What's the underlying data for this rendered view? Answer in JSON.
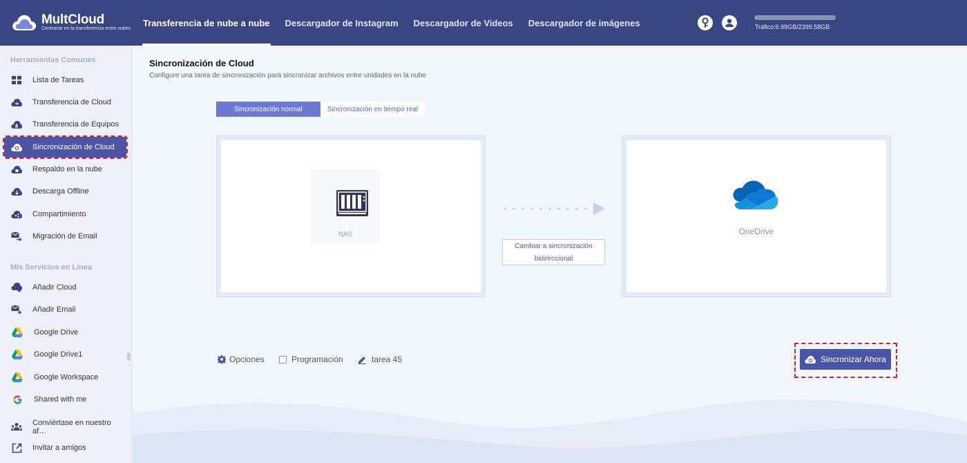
{
  "brand": {
    "name": "MultCloud",
    "tagline": "Centrarse en la transferencia entre nubes",
    "logo_icon": "cloud-logo-icon",
    "accent_color": "#3a4583"
  },
  "nav": {
    "items": [
      {
        "label": "Transferencia de nube a nube",
        "active": true
      },
      {
        "label": "Descargador de Instagram",
        "active": false
      },
      {
        "label": "Descargador de Videos",
        "active": false
      },
      {
        "label": "Descargador de imágenes",
        "active": false
      }
    ]
  },
  "header": {
    "help_icon": "key-icon",
    "user_icon": "user-icon",
    "traffic_text": "Tráfico:6.99GB/2399.58GB",
    "traffic_used_fraction": 0.003
  },
  "sidebar": {
    "common_heading": "Herramientas Comunes",
    "common_items": [
      {
        "label": "Lista de Tareas",
        "icon": "grid-icon"
      },
      {
        "label": "Transferencia de Cloud",
        "icon": "cloud-transfer-icon"
      },
      {
        "label": "Transferencia de Equipos",
        "icon": "team-cloud-icon"
      },
      {
        "label": "Sincronización de Cloud",
        "icon": "cloud-sync-icon",
        "active": true
      },
      {
        "label": "Respaldo en la nube",
        "icon": "cloud-backup-icon"
      },
      {
        "label": "Descarga Offline",
        "icon": "cloud-download-icon"
      },
      {
        "label": "Compartimiento",
        "icon": "cloud-share-icon"
      },
      {
        "label": "Migración de Email",
        "icon": "email-migration-icon"
      }
    ],
    "services_heading": "Mis Servicios en Línea",
    "service_items": [
      {
        "label": "Añadir Cloud",
        "icon": "add-cloud-icon"
      },
      {
        "label": "Añadir Email",
        "icon": "add-email-icon"
      },
      {
        "label": "Google Drive",
        "icon": "google-drive-icon"
      },
      {
        "label": "Google Drive1",
        "icon": "google-drive-icon"
      },
      {
        "label": "Google Workspace",
        "icon": "google-drive-icon"
      },
      {
        "label": "Shared with me",
        "icon": "google-icon"
      }
    ],
    "bottom_items": [
      {
        "label": "Conviértase en nuestro af…",
        "icon": "affiliate-icon"
      },
      {
        "label": "Invitar a amigos",
        "icon": "invite-icon"
      }
    ]
  },
  "main": {
    "title": "Sincronización de Cloud",
    "description": "Configure una tarea de sincronización para sincronizar archivos entre unidades en la nube",
    "tabs": {
      "normal": "Sincronización normal",
      "realtime": "Sincronización en tiempo real"
    },
    "source": {
      "label": "NAS",
      "icon": "nas-icon"
    },
    "destination": {
      "label": "OneDrive",
      "icon": "onedrive-icon"
    },
    "switch_button": {
      "line1": "Cambiar a sincronización",
      "line2": "bidireccional"
    },
    "options_label": "Opciones",
    "schedule_label": "Programación",
    "task_name": "tarea 45",
    "sync_now_label": "Sincronizar Ahora"
  }
}
